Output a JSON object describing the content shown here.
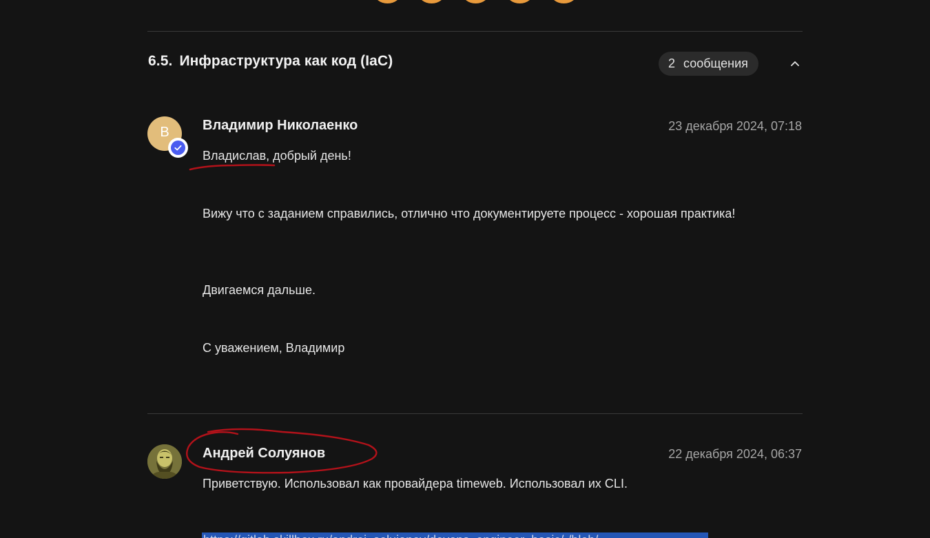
{
  "section": {
    "number": "6.5.",
    "title": "Инфраструктура как код (IaC)",
    "message_count": "2",
    "message_count_label": "сообщения"
  },
  "messages": [
    {
      "avatar_letter": "В",
      "author": "Владимир Николаенко",
      "date": "23 декабря 2024, 07:18",
      "paragraphs": [
        "Владислав, добрый день!",
        "Вижу что с заданием справились, отлично что документируете процесс - хорошая практика!",
        "Двигаемся дальше.",
        "С уважением, Владимир"
      ]
    },
    {
      "author": "Андрей Солуянов",
      "date": "22 декабря 2024, 06:37",
      "paragraphs": [
        "Приветствую. Использовал как провайдера timeweb. Использовал их CLI."
      ],
      "link": "https://gitlab.skillbox.ru/andrei_soluianov/devops_engineer_basic/-/blob/"
    }
  ],
  "colors": {
    "background": "#141414",
    "avatar_v": "#e2bd7b",
    "verified": "#4a5cf0",
    "pill": "#2b2b2b",
    "dots": "#e89a3c",
    "annotation": "#b3121a",
    "link_highlight": "#2456b5"
  },
  "icons": {
    "collapse": "chevron-up-icon",
    "verified": "check-badge-icon"
  }
}
